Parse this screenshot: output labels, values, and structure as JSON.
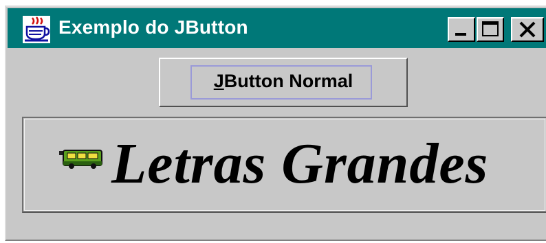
{
  "window": {
    "title": "Exemplo do JButton",
    "icon": "java-coffee-cup-icon",
    "controls": [
      "minimize-icon",
      "maximize-icon",
      "close-icon"
    ],
    "titlebar_color": "#007878"
  },
  "normal_button": {
    "mnemonic": "J",
    "label_rest": "Button Normal"
  },
  "big_button": {
    "icon": "bus-icon",
    "label": "Letras Grandes"
  }
}
